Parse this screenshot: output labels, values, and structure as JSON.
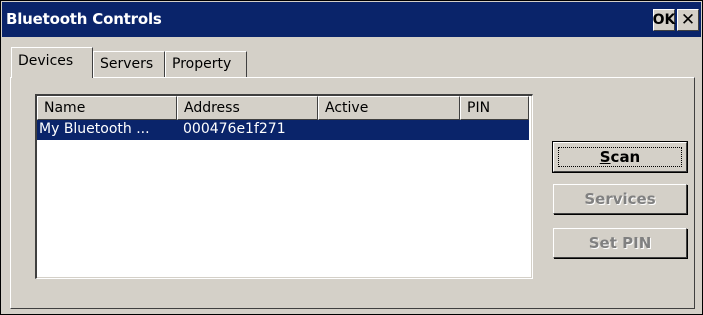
{
  "window": {
    "title": "Bluetooth Controls",
    "ok_label": "OK",
    "close_label": "✕"
  },
  "tabs": [
    {
      "label": "Devices",
      "active": true
    },
    {
      "label": "Servers",
      "active": false
    },
    {
      "label": "Property",
      "active": false
    }
  ],
  "device_list": {
    "columns": [
      "Name",
      "Address",
      "Active",
      "PIN"
    ],
    "rows": [
      {
        "name": "My Bluetooth ...",
        "address": "000476e1f271",
        "active": "",
        "pin": "",
        "selected": true
      }
    ]
  },
  "buttons": {
    "scan": {
      "label_underlined": "S",
      "label_rest": "can",
      "enabled": true
    },
    "services": {
      "label": "Services",
      "enabled": false
    },
    "set_pin": {
      "label": "Set PIN",
      "enabled": false
    }
  },
  "colors": {
    "titlebar": "#0a246a",
    "selection": "#0a246a",
    "face": "#d4d0c8"
  }
}
